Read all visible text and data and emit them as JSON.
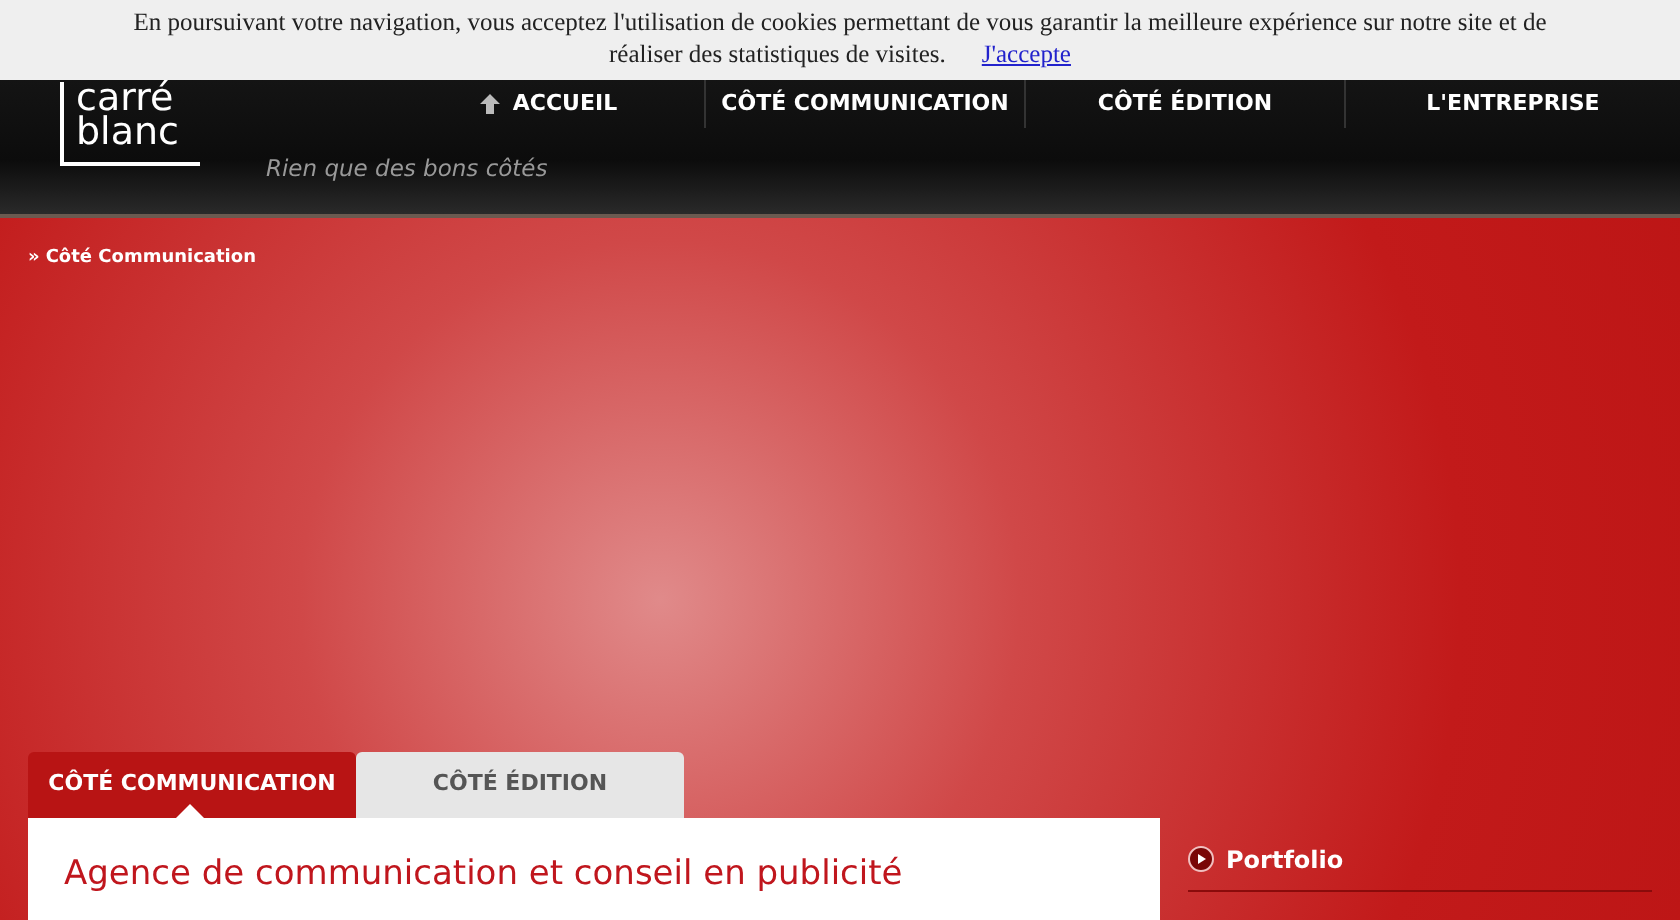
{
  "cookie_banner": {
    "lines": [
      "En poursuivant votre navigation, vous acceptez l'utilisation de cookies permettant de vous garantir la meilleure expérience sur notre site et de",
      "réaliser des statistiques de visites."
    ],
    "link": "J'accepte"
  },
  "header": {
    "logo": [
      "carré",
      "blanc"
    ],
    "tagline": "Rien que des bons côtés",
    "nav": [
      {
        "label": "ACCUEIL",
        "kind": "home"
      },
      {
        "label": "CÔTÉ COMMUNICATION",
        "kind": "plain"
      },
      {
        "label": "CÔTÉ ÉDITION",
        "kind": "plain"
      },
      {
        "label": "L'ENTREPRISE",
        "kind": "plain"
      }
    ]
  },
  "breadcrumb": {
    "marker": "»",
    "label": "Côté Communication"
  },
  "tabs": [
    {
      "label": "CÔTÉ COMMUNICATION",
      "selected": true
    },
    {
      "label": "CÔTÉ ÉDITION",
      "selected": false
    }
  ],
  "content": {
    "heading": "Agence de communication et conseil en publicité"
  },
  "sidebar": {
    "items": [
      {
        "label": "Portfolio"
      }
    ]
  }
}
